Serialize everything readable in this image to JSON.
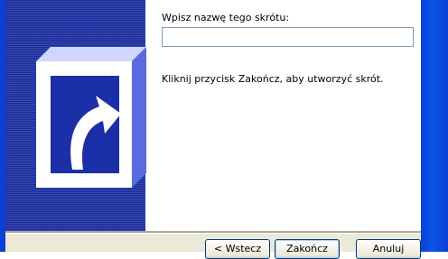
{
  "wizard": {
    "name_prompt": "Wpisz nazwę tego skrótu:",
    "name_value": "",
    "finish_hint": "Kliknij przycisk Zakończ, aby utworzyć skrót."
  },
  "buttons": {
    "back": "< Wstecz",
    "finish": "Zakończ",
    "cancel": "Anuluj"
  },
  "colors": {
    "side_panel": "#1b2fa8",
    "frame": "#0b3fd6",
    "dialog_face": "#ece9d8"
  },
  "icons": {
    "side_art": "shortcut-arrow-icon"
  }
}
